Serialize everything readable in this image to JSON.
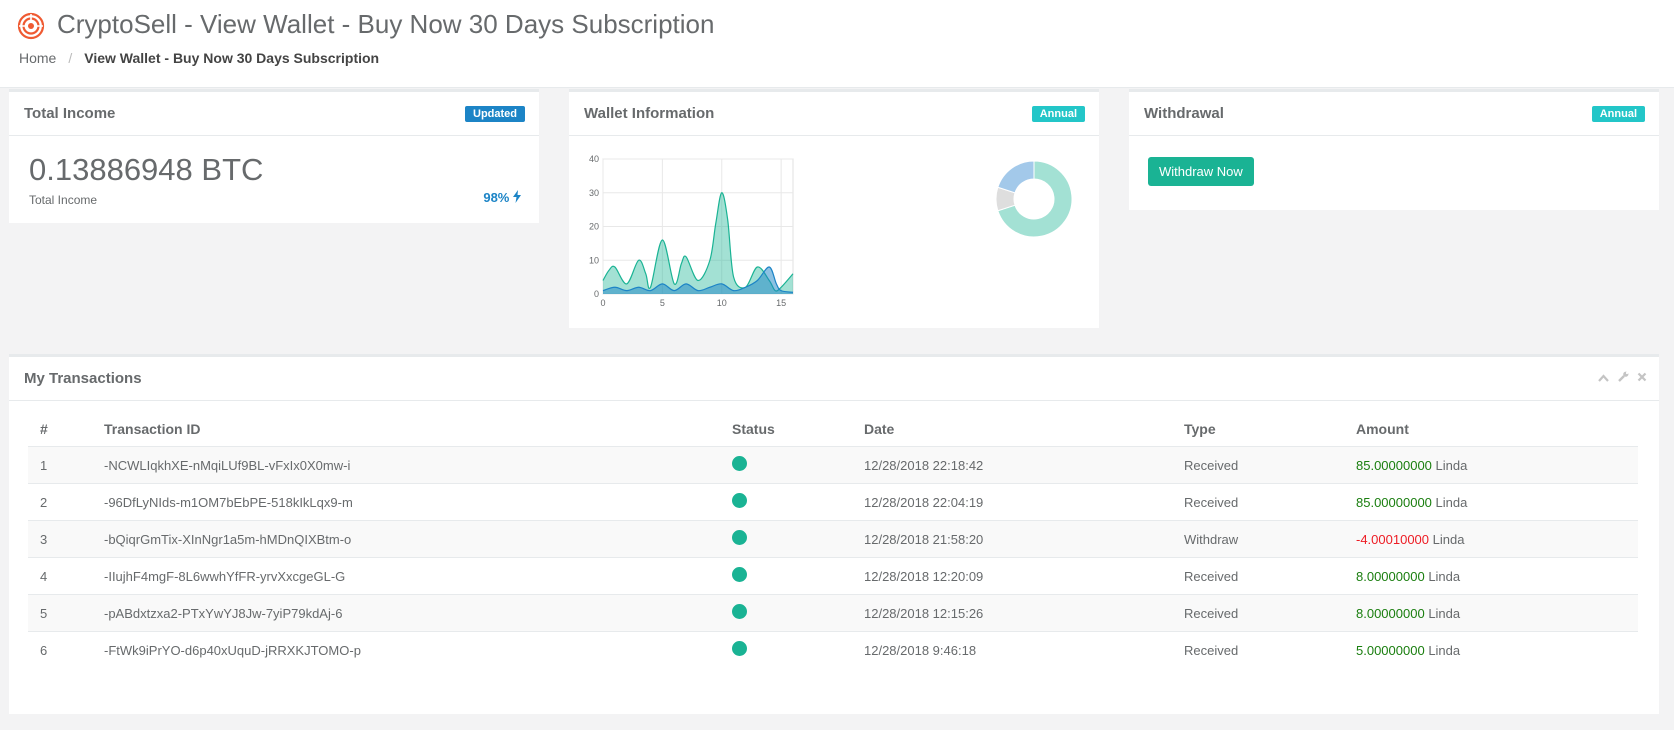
{
  "header": {
    "title": "CryptoSell - View Wallet - Buy Now 30 Days Subscription",
    "breadcrumb": {
      "home": "Home",
      "separator": "/",
      "current": "View Wallet - Buy Now 30 Days Subscription"
    }
  },
  "income": {
    "title": "Total Income",
    "badge": "Updated",
    "value": "0.13886948 BTC",
    "sub": "Total Income",
    "percent": "98%"
  },
  "wallet": {
    "title": "Wallet Information",
    "badge": "Annual"
  },
  "withdrawal": {
    "title": "Withdrawal",
    "badge": "Annual",
    "button": "Withdraw Now"
  },
  "transactions": {
    "title": "My Transactions",
    "headers": {
      "num": "#",
      "id": "Transaction ID",
      "status": "Status",
      "date": "Date",
      "type": "Type",
      "amount": "Amount"
    },
    "rows": [
      {
        "num": "1",
        "id": "-NCWLIqkhXE-nMqiLUf9BL-vFxIx0X0mw-i",
        "date": "12/28/2018 22:18:42",
        "type": "Received",
        "amount": "85.00000000",
        "user": "Linda"
      },
      {
        "num": "2",
        "id": "-96DfLyNIds-m1OM7bEbPE-518kIkLqx9-m",
        "date": "12/28/2018 22:04:19",
        "type": "Received",
        "amount": "85.00000000",
        "user": "Linda"
      },
      {
        "num": "3",
        "id": "-bQiqrGmTix-XInNgr1a5m-hMDnQIXBtm-o",
        "date": "12/28/2018 21:58:20",
        "type": "Withdraw",
        "amount": "-4.00010000",
        "user": "Linda"
      },
      {
        "num": "4",
        "id": "-IIujhF4mgF-8L6wwhYfFR-yrvXxcgeGL-G",
        "date": "12/28/2018 12:20:09",
        "type": "Received",
        "amount": "8.00000000",
        "user": "Linda"
      },
      {
        "num": "5",
        "id": "-pABdxtzxa2-PTxYwYJ8Jw-7yiP79kdAj-6",
        "date": "12/28/2018 12:15:26",
        "type": "Received",
        "amount": "8.00000000",
        "user": "Linda"
      },
      {
        "num": "6",
        "id": "-FtWk9iPrYO-d6p40xUquD-jRRXKJTOMO-p",
        "date": "12/28/2018 9:46:18",
        "type": "Received",
        "amount": "5.00000000",
        "user": "Linda"
      }
    ]
  },
  "colors": {
    "accent": "#1ab394",
    "blue": "#1c84c6",
    "teal": "#23c6c8",
    "received": "#1a7e0f",
    "withdraw": "#ed1c24"
  },
  "icons": [
    "logo-icon",
    "bolt-icon",
    "chevron-up-icon",
    "wrench-icon",
    "close-icon"
  ],
  "chart_data": [
    {
      "type": "area",
      "xlim": [
        0,
        16
      ],
      "ylim": [
        0,
        40
      ],
      "xticks": [
        0,
        5,
        10,
        15
      ],
      "yticks": [
        0,
        10,
        20,
        30,
        40
      ],
      "grid": true,
      "series": [
        {
          "color": "#1ab394",
          "x": [
            0,
            0.5,
            1,
            2,
            3,
            3.6,
            4,
            5,
            6,
            6.6,
            7,
            8,
            9,
            9.5,
            10,
            10.5,
            11,
            12,
            13,
            14,
            14.5,
            15,
            16
          ],
          "values": [
            4,
            7,
            8,
            3,
            10,
            6,
            2,
            16,
            3,
            9,
            11,
            4,
            10,
            21,
            30,
            22,
            5,
            2,
            8,
            4,
            1,
            2,
            6
          ]
        },
        {
          "color": "#1c84c6",
          "x": [
            0,
            1,
            2,
            3,
            4,
            5,
            6,
            7,
            8,
            9,
            10,
            11,
            12,
            13,
            14,
            14.6,
            15,
            16
          ],
          "values": [
            1,
            2,
            1,
            2,
            1,
            3,
            1,
            3,
            1,
            2,
            3,
            1,
            2,
            4,
            8,
            3,
            1,
            0.5
          ]
        }
      ]
    },
    {
      "type": "pie",
      "donut": true,
      "values": [
        70,
        10,
        20
      ],
      "colors": [
        "#a3e1d4",
        "#dedede",
        "#a3c9ea"
      ]
    }
  ]
}
